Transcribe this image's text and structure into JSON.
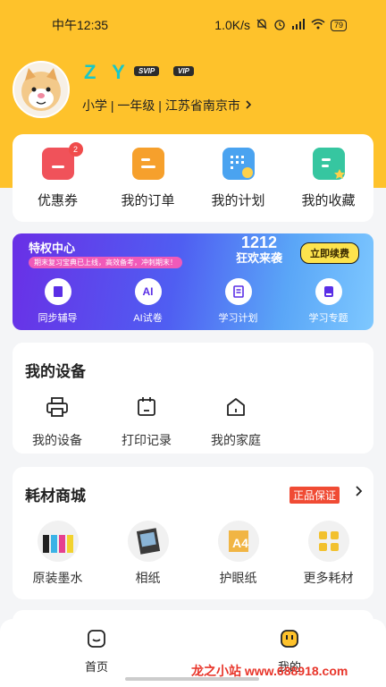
{
  "status_bar": {
    "time": "中午12:35",
    "network_speed": "1.0K/s",
    "battery": "79"
  },
  "profile": {
    "username": "Z Y",
    "badge_svip": "SVIP",
    "badge_vip": "VIP",
    "info": "小学 | 一年级 | 江苏省南京市"
  },
  "quick_actions": [
    {
      "label": "优惠券",
      "icon": "coupon-icon",
      "badge": "2",
      "color": "#f0525a"
    },
    {
      "label": "我的订单",
      "icon": "order-icon",
      "color": "#f6a02c"
    },
    {
      "label": "我的计划",
      "icon": "calendar-plan-icon",
      "color": "#4aa3f0"
    },
    {
      "label": "我的收藏",
      "icon": "favorite-icon",
      "color": "#36c6a0"
    }
  ],
  "vip_center": {
    "title": "特权中心",
    "subtitle": "期末复习宝典已上线，高效备考，冲刺期末！",
    "promo_line1": "1212",
    "promo_line2": "狂欢来袭",
    "renew_button": "立即续费",
    "items": [
      {
        "label": "同步辅导",
        "icon": "book-icon"
      },
      {
        "label": "AI试卷",
        "icon": "ai-icon",
        "glyph": "AI"
      },
      {
        "label": "学习计划",
        "icon": "plan-icon"
      },
      {
        "label": "学习专题",
        "icon": "topic-icon"
      }
    ]
  },
  "devices": {
    "title": "我的设备",
    "items": [
      {
        "label": "我的设备",
        "icon": "printer-icon"
      },
      {
        "label": "打印记录",
        "icon": "calendar-icon"
      },
      {
        "label": "我的家庭",
        "icon": "home-icon"
      }
    ]
  },
  "shop": {
    "title": "耗材商城",
    "guarantee": "正品保证",
    "items": [
      {
        "label": "原装墨水",
        "icon": "ink-bottles-icon"
      },
      {
        "label": "相纸",
        "icon": "photo-paper-icon"
      },
      {
        "label": "护眼纸",
        "icon": "eye-care-paper-icon"
      },
      {
        "label": "更多耗材",
        "icon": "grid-more-icon"
      }
    ]
  },
  "tabbar": {
    "home": "首页",
    "mine": "我的"
  },
  "watermark": "龙之小站 www.688918.com",
  "colors": {
    "header": "#fec22b",
    "accent_cyan": "#18c7c7",
    "red": "#f04b34"
  }
}
